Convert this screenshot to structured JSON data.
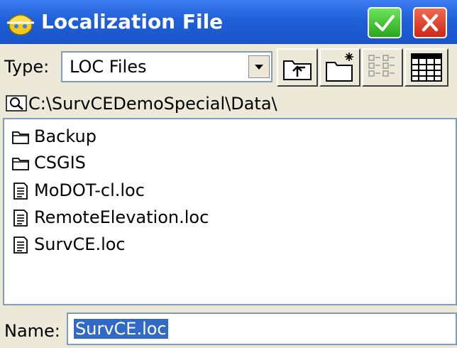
{
  "window": {
    "title": "Localization File",
    "ok_icon": "checkmark-icon",
    "close_icon": "close-x-icon",
    "accent": "#1f5fd8"
  },
  "type_row": {
    "label": "Type:",
    "selected": "LOC Files",
    "tools": [
      "up-folder-icon",
      "new-folder-icon",
      "list-view-icon",
      "detail-view-icon"
    ]
  },
  "path": {
    "icon": "folder-search-icon",
    "value": "C:\\SurvCEDemoSpecial\\Data\\"
  },
  "files": [
    {
      "name": "Backup",
      "icon": "folder-icon"
    },
    {
      "name": "CSGIS",
      "icon": "folder-icon"
    },
    {
      "name": "MoDOT-cl.loc",
      "icon": "document-icon"
    },
    {
      "name": "RemoteElevation.loc",
      "icon": "document-icon"
    },
    {
      "name": "SurvCE.loc",
      "icon": "document-icon"
    }
  ],
  "name_row": {
    "label": "Name:",
    "value": "SurvCE.loc"
  }
}
